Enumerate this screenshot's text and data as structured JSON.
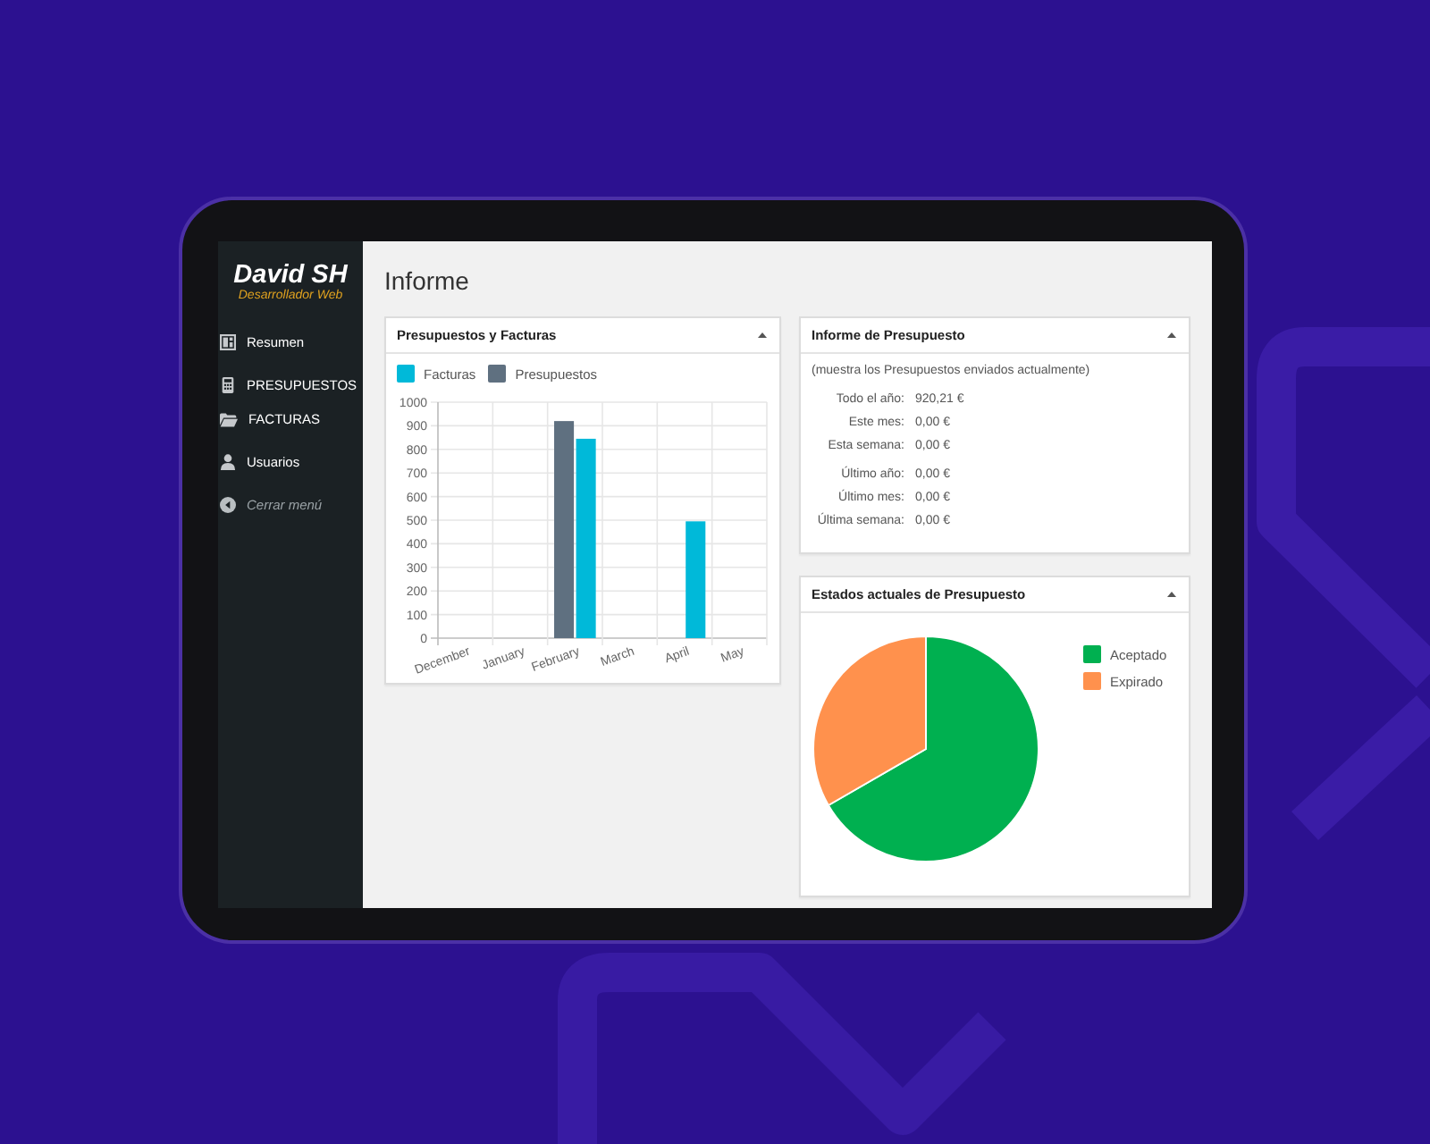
{
  "sidebar": {
    "logo": {
      "title": "David SH",
      "subtitle": "Desarrollador Web"
    },
    "sections": [
      {
        "items": [
          {
            "label": "Resumen",
            "kind": "link"
          }
        ]
      },
      {
        "items": [
          {
            "label": "PRESUPUESTOS",
            "kind": "link"
          },
          {
            "label": "FACTURAS",
            "kind": "link"
          }
        ]
      },
      {
        "items": [
          {
            "label": "Usuarios",
            "kind": "link"
          }
        ]
      },
      {
        "items": [
          {
            "label": "Cerrar menú",
            "kind": "toggle"
          }
        ]
      }
    ]
  },
  "page": {
    "title": "Informe"
  },
  "budget_invoice_card": {
    "title": "Presupuestos y Facturas",
    "chart_data": {
      "type": "bar",
      "legend": true,
      "grid": true,
      "categories": [
        "December",
        "January",
        "February",
        "March",
        "April",
        "May"
      ],
      "series": [
        {
          "name": "Facturas",
          "color": "#00b9d9",
          "values": [
            0,
            0,
            845,
            0,
            495,
            0
          ]
        },
        {
          "name": "Presupuestos",
          "color": "#5f7080",
          "values": [
            0,
            0,
            920,
            0,
            0,
            0
          ]
        }
      ],
      "ylim": [
        0,
        1000
      ],
      "yticks": [
        0,
        100,
        200,
        300,
        400,
        500,
        600,
        700,
        800,
        900,
        1000
      ]
    }
  },
  "report_card": {
    "title": "Informe de Presupuesto",
    "note": "(muestra los Presupuestos enviados actualmente)",
    "groups": [
      {
        "rows": [
          {
            "label": "Todo el año:",
            "value": "920,21 €"
          },
          {
            "label": "Este mes:",
            "value": "0,00 €"
          },
          {
            "label": "Esta semana:",
            "value": "0,00 €"
          }
        ]
      },
      {
        "rows": [
          {
            "label": "Último año:",
            "value": "0,00 €"
          },
          {
            "label": "Último mes:",
            "value": "0,00 €"
          },
          {
            "label": "Última semana:",
            "value": "0,00 €"
          }
        ]
      }
    ]
  },
  "status_card": {
    "title": "Estados actuales de Presupuesto",
    "legend": [
      {
        "label": "Aceptado",
        "color": "#00b050"
      },
      {
        "label": "Expirado",
        "color": "#ff914d"
      }
    ]
  }
}
